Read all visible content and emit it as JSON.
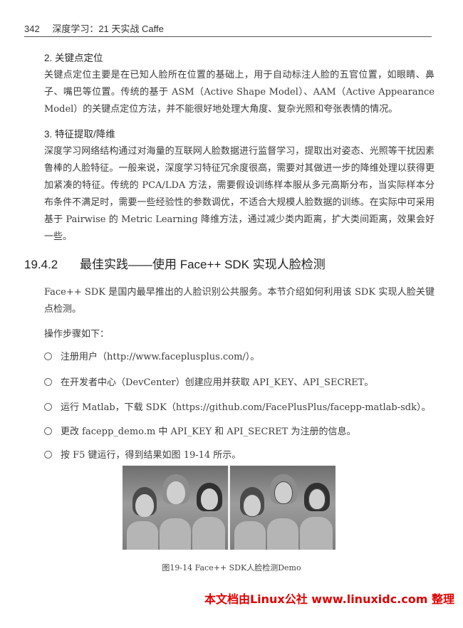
{
  "header": {
    "page_number": "342",
    "book_title": "深度学习：21 天实战 Caffe"
  },
  "sections": {
    "s2_title": "2.  关键点定位",
    "s2_body": "关键点定位主要是在已知人脸所在位置的基础上，用于自动标注人脸的五官位置，如眼睛、鼻子、嘴巴等位置。传统的基于 ASM（Active Shape Model）、AAM（Active Appearance Model）的关键点定位方法，并不能很好地处理大角度、复杂光照和夸张表情的情况。",
    "s3_title": "3.  特征提取/降维",
    "s3_body": "深度学习网络结构通过对海量的互联网人脸数据进行监督学习，提取出对姿态、光照等干扰因素鲁棒的人脸特征。一般来说，深度学习特征冗余度很高，需要对其做进一步的降维处理以获得更加紧凑的特征。传统的 PCA/LDA 方法，需要假设训练样本服从多元高斯分布，当实际样本分布条件不满足时，需要一些经验性的参数调优，不适合大规模人脸数据的训练。在实际中可采用基于 Pairwise 的 Metric Learning 降维方法，通过减少类内距离，扩大类间距离，效果会好一些。"
  },
  "section_19_4_2": {
    "number": "19.4.2",
    "title": "最佳实践——使用 Face++ SDK 实现人脸检测",
    "intro": "Face++ SDK 是国内最早推出的人脸识别公共服务。本节介绍如何利用该 SDK 实现人脸关键点检测。",
    "steps_label": "操作步骤如下：",
    "steps": [
      "注册用户（http://www.faceplusplus.com/）。",
      "在开发者中心（DevCenter）创建应用并获取 API_KEY、API_SECRET。",
      "运行 Matlab，下载 SDK（https://github.com/FacePlusPlus/facepp-matlab-sdk）。",
      "更改 facepp_demo.m 中 API_KEY 和 API_SECRET 为注册的信息。",
      "按 F5 键运行，得到结果如图 19-14 所示。"
    ]
  },
  "figure": {
    "caption": "图19-14    Face++ SDK人脸检测Demo"
  },
  "watermark": "本文档由Linux公社 www.linuxidc.com 整理",
  "colors": {
    "watermark": "#e00000",
    "text": "#3b3b3b"
  }
}
